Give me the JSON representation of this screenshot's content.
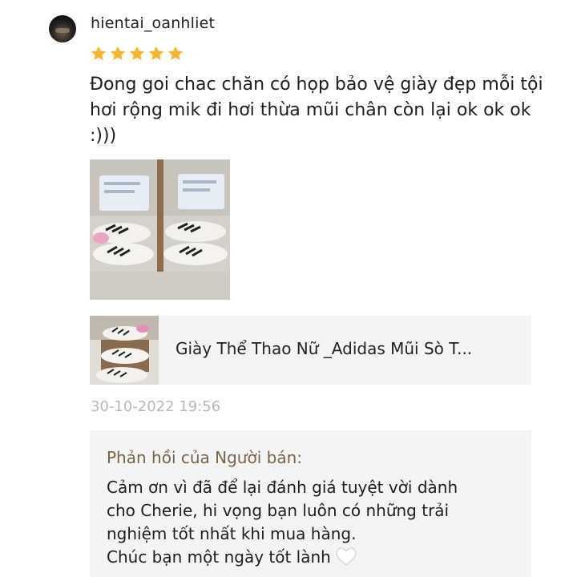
{
  "review": {
    "username": "hientai_oanhliet",
    "rating": 5,
    "rating_max": 5,
    "star_color": "#f7b52c",
    "comment": "Đong goi chac chăn có họp bảo vệ giày đẹp mỗi tội hơi rộng mik đi hơi thừa mũi chân còn lại ok ok ok :)))",
    "timestamp": "30-10-2022 19:56"
  },
  "product": {
    "name": "Giày Thể Thao Nữ _Adidas Mũi Sò T..."
  },
  "seller_reply": {
    "title": "Phản hồi của Người bán:",
    "line1": "Cảm ơn vì đã để lại đánh giá tuyệt vời dành",
    "line2": "cho Cherie, hi vọng bạn luôn có những trải",
    "line3": "nghiệm tốt nhất khi mua hàng.",
    "line4": "Chúc bạn một ngày tốt lành",
    "emoji_icon": "white-heart-icon"
  }
}
